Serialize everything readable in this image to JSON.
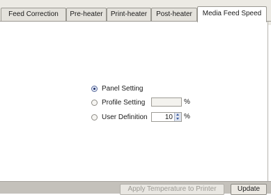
{
  "tabs": [
    {
      "label": "Feed Correction",
      "active": false
    },
    {
      "label": "Pre-heater",
      "active": false
    },
    {
      "label": "Print-heater",
      "active": false
    },
    {
      "label": "Post-heater",
      "active": false
    },
    {
      "label": "Media Feed Speed",
      "active": true
    }
  ],
  "options": {
    "panel_setting": {
      "label": "Panel Setting",
      "selected": true
    },
    "profile_setting": {
      "label": "Profile Setting",
      "value": "",
      "unit": "%"
    },
    "user_definition": {
      "label": "User Definition",
      "value": "10",
      "unit": "%"
    }
  },
  "buttons": {
    "apply_label": "Apply Temperature to Printer",
    "update_label": "Update"
  }
}
